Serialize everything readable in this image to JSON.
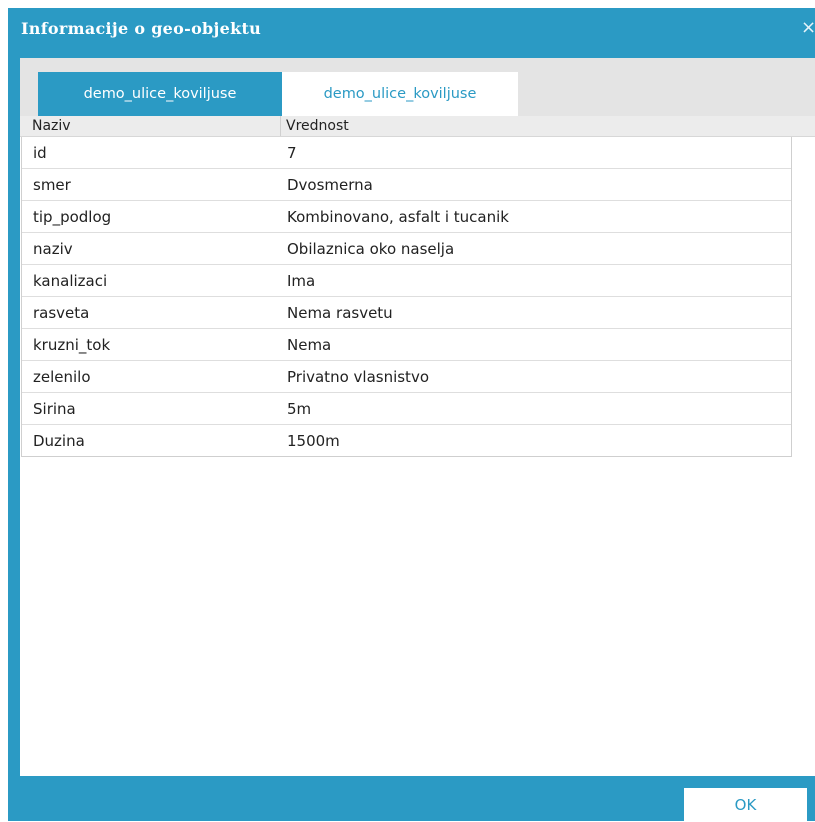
{
  "dialog": {
    "title": "Informacije o geo-objektu",
    "close_symbol": "×"
  },
  "tabs": [
    {
      "label": "demo_ulice_koviljuse",
      "active": true
    },
    {
      "label": "demo_ulice_koviljuse",
      "active": false
    }
  ],
  "grid": {
    "columns": {
      "name": "Naziv",
      "value": "Vrednost"
    },
    "rows": [
      {
        "name": "id",
        "value": "7"
      },
      {
        "name": "smer",
        "value": "Dvosmerna"
      },
      {
        "name": "tip_podlog",
        "value": "Kombinovano, asfalt i tucanik"
      },
      {
        "name": "naziv",
        "value": "Obilaznica oko naselja"
      },
      {
        "name": "kanalizaci",
        "value": "Ima"
      },
      {
        "name": "rasveta",
        "value": "Nema rasvetu"
      },
      {
        "name": "kruzni_tok",
        "value": "Nema"
      },
      {
        "name": "zelenilo",
        "value": "Privatno vlasnistvo"
      },
      {
        "name": "Sirina",
        "value": "5m"
      },
      {
        "name": "Duzina",
        "value": "1500m"
      }
    ]
  },
  "footer": {
    "ok_label": "OK"
  },
  "colors": {
    "accent": "#2b9ac4",
    "tab_strip": "#e4e4e4",
    "header_bg": "#ececec"
  }
}
